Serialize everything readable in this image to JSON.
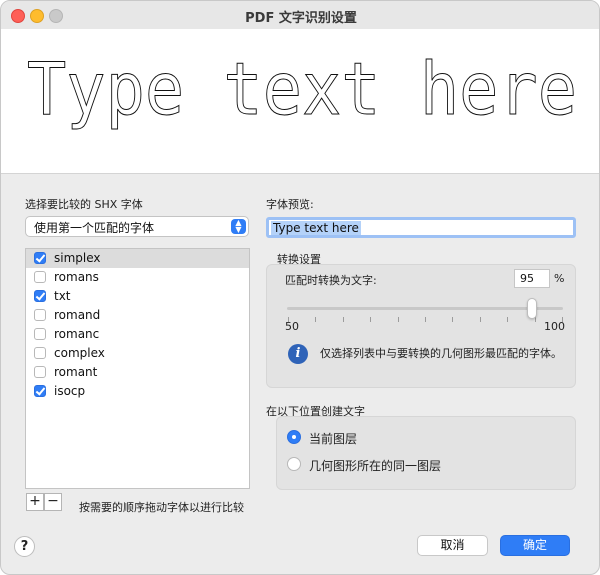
{
  "window": {
    "title": "PDF 文字识别设置"
  },
  "preview": {
    "sample_text": "Type text here"
  },
  "font_compare": {
    "label": "选择要比较的 SHX 字体",
    "popup_value": "使用第一个匹配的字体",
    "fonts": [
      {
        "name": "simplex",
        "checked": true,
        "selected": true
      },
      {
        "name": "romans",
        "checked": false,
        "selected": false
      },
      {
        "name": "txt",
        "checked": true,
        "selected": false
      },
      {
        "name": "romand",
        "checked": false,
        "selected": false
      },
      {
        "name": "romanc",
        "checked": false,
        "selected": false
      },
      {
        "name": "complex",
        "checked": false,
        "selected": false
      },
      {
        "name": "romant",
        "checked": false,
        "selected": false
      },
      {
        "name": "isocp",
        "checked": true,
        "selected": false
      }
    ],
    "add_label": "+",
    "remove_label": "−",
    "hint": "按需要的顺序拖动字体以进行比较"
  },
  "font_preview": {
    "label": "字体预览:",
    "value": "Type text here"
  },
  "conversion": {
    "title": "转换设置",
    "match_label": "匹配时转换为文字:",
    "match_value": "95",
    "unit": "%",
    "slider_min": "50",
    "slider_max": "100",
    "slider_value": 95,
    "info_text": "仅选择列表中与要转换的几何图形最匹配的字体。"
  },
  "create_text": {
    "title": "在以下位置创建文字",
    "options": [
      {
        "label": "当前图层",
        "selected": true
      },
      {
        "label": "几何图形所在的同一图层",
        "selected": false
      }
    ]
  },
  "buttons": {
    "help": "?",
    "cancel": "取消",
    "ok": "确定"
  },
  "colors": {
    "accent": "#2f7df6",
    "info_icon": "#2f63b8",
    "close": "#fe5f57",
    "minimize": "#febc2e",
    "maximize": "#c9c9c9"
  }
}
